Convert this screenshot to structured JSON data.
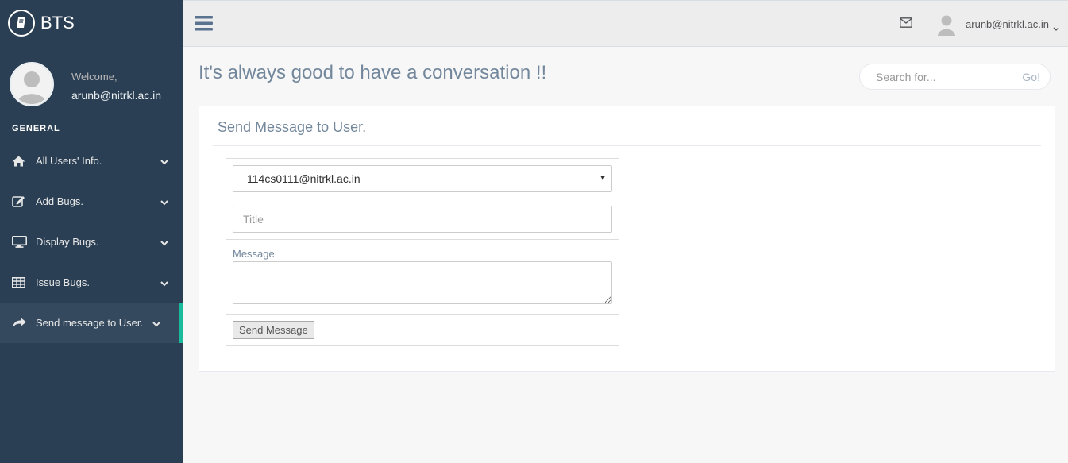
{
  "app": {
    "name": "BTS"
  },
  "profile": {
    "welcome": "Welcome,",
    "email": "arunb@nitrkl.ac.in"
  },
  "sidebar": {
    "section": "GENERAL",
    "items": [
      {
        "label": "All Users' Info.",
        "icon": "home-icon"
      },
      {
        "label": "Add Bugs.",
        "icon": "edit-icon"
      },
      {
        "label": "Display Bugs.",
        "icon": "desktop-icon"
      },
      {
        "label": "Issue Bugs.",
        "icon": "table-icon"
      },
      {
        "label": "Send message to User.",
        "icon": "share-icon",
        "active": true
      }
    ]
  },
  "topbar": {
    "user": "arunb@nitrkl.ac.in"
  },
  "page": {
    "title": "It's always good to have a conversation !!"
  },
  "search": {
    "placeholder": "Search for...",
    "go_label": "Go!"
  },
  "panel": {
    "title": "Send Message to User.",
    "recipient": "114cs0111@nitrkl.ac.in",
    "title_placeholder": "Title",
    "message_label": "Message",
    "send_label": "Send Message"
  },
  "colors": {
    "sidebar": "#2a3f54",
    "active_accent": "#1abb9c",
    "heading": "#73879c"
  }
}
